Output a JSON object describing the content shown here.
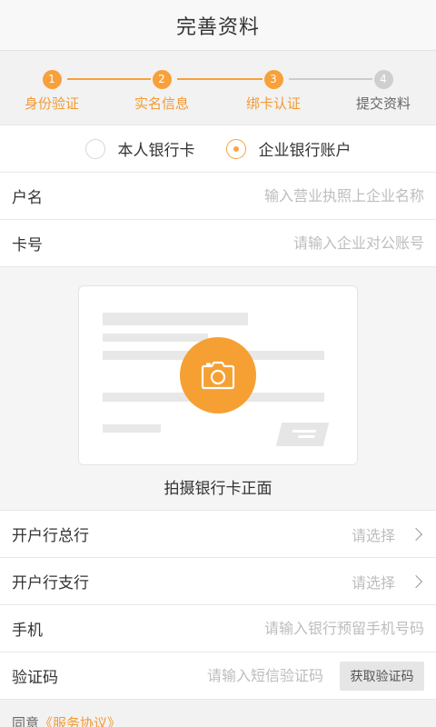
{
  "header": {
    "title": "完善资料"
  },
  "steps": [
    {
      "num": "1",
      "label": "身份验证",
      "state": "done"
    },
    {
      "num": "2",
      "label": "实名信息",
      "state": "done"
    },
    {
      "num": "3",
      "label": "绑卡认证",
      "state": "current"
    },
    {
      "num": "4",
      "label": "提交资料",
      "state": "todo"
    }
  ],
  "card_type": {
    "options": [
      "本人银行卡",
      "企业银行账户"
    ],
    "selected": "企业银行账户"
  },
  "form": {
    "account_name": {
      "label": "户名",
      "placeholder": "输入营业执照上企业名称"
    },
    "card_number": {
      "label": "卡号",
      "placeholder": "请输入企业对公账号"
    },
    "photo": {
      "caption": "拍摄银行卡正面",
      "icon": "camera-icon"
    },
    "bank_head": {
      "label": "开户行总行",
      "value": "请选择",
      "icon": "chevron-right-icon"
    },
    "bank_branch": {
      "label": "开户行支行",
      "value": "请选择",
      "icon": "chevron-right-icon"
    },
    "phone": {
      "label": "手机",
      "placeholder": "请输入银行预留手机号码"
    },
    "sms_code": {
      "label": "验证码",
      "placeholder": "请输入短信验证码",
      "button": "获取验证码"
    }
  },
  "agreement": {
    "prefix": "同意",
    "link": "《服务协议》"
  },
  "colors": {
    "accent": "#f8a03a",
    "inactive": "#cfcfcf",
    "background": "#f7f7f7"
  }
}
